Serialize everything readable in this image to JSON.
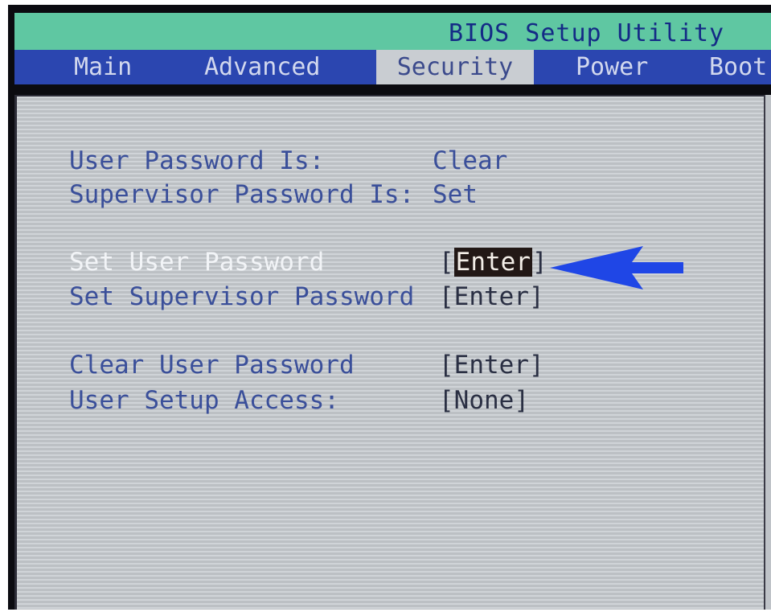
{
  "app": {
    "title": "BIOS Setup Utility"
  },
  "tabs": [
    {
      "label": "Main"
    },
    {
      "label": "Advanced"
    },
    {
      "label": "Security",
      "active": true
    },
    {
      "label": "Power"
    },
    {
      "label": "Boot"
    }
  ],
  "security": {
    "user_password": {
      "label": "User Password Is:",
      "value": "Clear"
    },
    "supervisor_password": {
      "label": "Supervisor Password Is:",
      "value": "Set"
    },
    "set_user_password": {
      "label": "Set User Password",
      "open": "[",
      "value": "Enter",
      "close": "]"
    },
    "set_supervisor_password": {
      "label": "Set Supervisor Password",
      "value": "[Enter]"
    },
    "clear_user_password": {
      "label": "Clear User Password",
      "value": "[Enter]"
    },
    "user_setup_access": {
      "label": "User Setup Access:",
      "value": "[None]"
    }
  },
  "annotation": {
    "icon": "arrow-left-icon",
    "color": "#1f46e6"
  },
  "colors": {
    "title_bar": "#5fc7a2",
    "menu_bar": "#2b46b0",
    "panel": "#c6cacf",
    "text": "#3a4f9a",
    "highlight_text": "#f2f4f7"
  }
}
